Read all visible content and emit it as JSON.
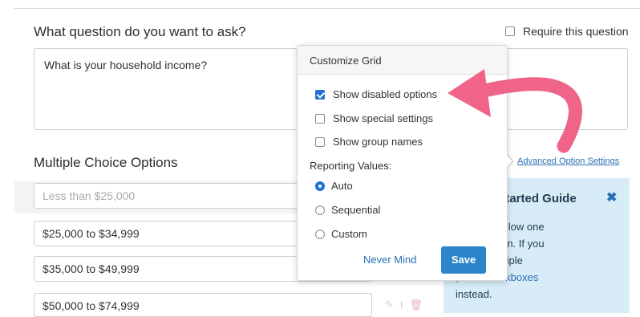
{
  "question": {
    "title": "What question do you want to ask?",
    "require_label": "Require this question",
    "require_checked": false,
    "text": "What is your household income?"
  },
  "multiple_choice": {
    "title": "Multiple Choice Options",
    "advanced_link": "Advanced Option Settings",
    "options": [
      {
        "label": "Less than $25,000",
        "disabled": true
      },
      {
        "label": "$25,000 to $34,999",
        "disabled": false
      },
      {
        "label": "$35,000 to $49,999",
        "disabled": false
      },
      {
        "label": "$50,000 to $74,999",
        "disabled": false
      }
    ]
  },
  "popover": {
    "title": "Customize Grid",
    "checkboxes": [
      {
        "label": "Show disabled options",
        "checked": true
      },
      {
        "label": "Show special settings",
        "checked": false
      },
      {
        "label": "Show group names",
        "checked": false
      }
    ],
    "reporting_label": "Reporting Values:",
    "radios": [
      {
        "label": "Auto",
        "selected": true
      },
      {
        "label": "Sequential",
        "selected": false
      },
      {
        "label": "Custom",
        "selected": false
      }
    ],
    "cancel_label": "Never Mind",
    "save_label": "Save"
  },
  "guide": {
    "title": "g Started Guide",
    "close_glyph": "✖",
    "lines": [
      "tons only allow one",
      "per question. If you",
      "ow for multiple",
      ", use"
    ],
    "link_text": "Checkboxes",
    "tail": "instead."
  },
  "colors": {
    "accent": "#1f6fd6",
    "link": "#2a6fb5",
    "save_button": "#2b86c9",
    "annotation_arrow": "#f0648a",
    "guide_background": "#d7ecf7"
  }
}
